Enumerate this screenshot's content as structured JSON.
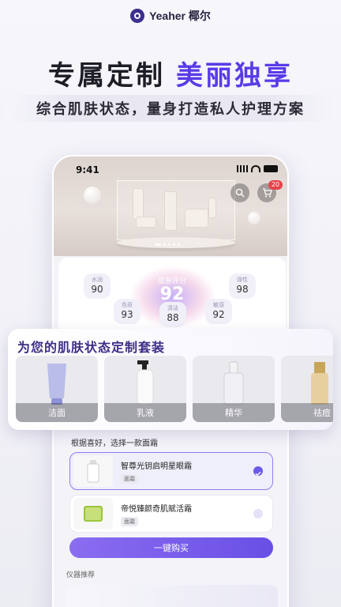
{
  "brand": {
    "name": "Yeaher 椰尔"
  },
  "headline": {
    "part1": "专属定制",
    "part2": "美丽独享"
  },
  "subheadline": "综合肌肤状态，量身打造私人护理方案",
  "phone": {
    "status_time": "9:41",
    "cart_badge": "20",
    "skin": {
      "score_label": "皮肤评分",
      "score": "92",
      "metrics": [
        {
          "label": "水润",
          "value": "90"
        },
        {
          "label": "弹性",
          "value": "98"
        },
        {
          "label": "色斑",
          "value": "93"
        },
        {
          "label": "敏感",
          "value": "92"
        },
        {
          "label": "清洁",
          "value": "88"
        }
      ]
    },
    "preference_title": "根据喜好，选择一款面霜",
    "options": [
      {
        "name": "智尊光钥启明星眼霜",
        "tag": "面霜",
        "selected": true
      },
      {
        "name": "帝悦臻颜奇肌赋活霜",
        "tag": "面霜",
        "selected": false
      }
    ],
    "buy_button": "一键购买",
    "device_title": "仪器推荐"
  },
  "overlay": {
    "title": "为您的肌肤状态定制套装",
    "products": [
      {
        "label": "洁面"
      },
      {
        "label": "乳液"
      },
      {
        "label": "精华"
      },
      {
        "label": "祛痘"
      }
    ]
  },
  "colors": {
    "accent": "#5a3be8",
    "title_purple": "#3f2d86",
    "button": "#6a4fe6"
  }
}
